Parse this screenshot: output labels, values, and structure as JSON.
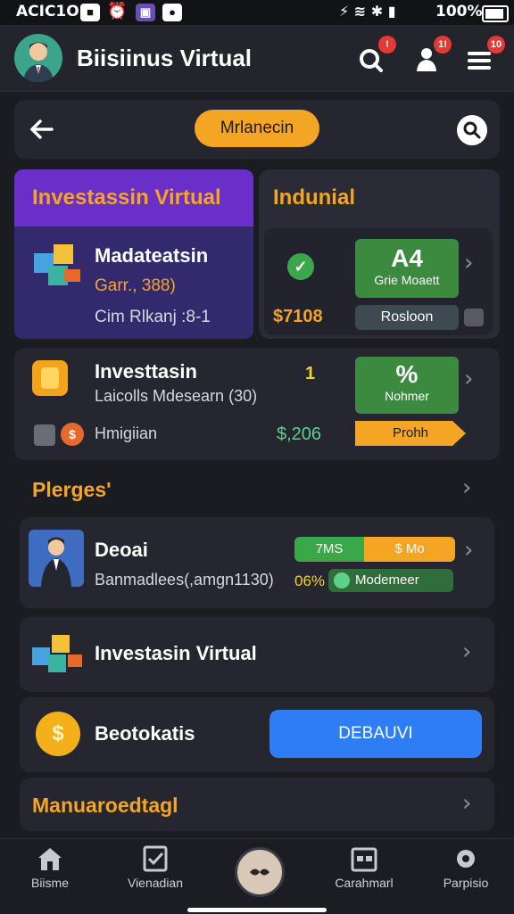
{
  "status_bar": {
    "time": "ACIC1O",
    "battery": "100%"
  },
  "header": {
    "title": "Biisiinus Virtual",
    "badges": [
      "!",
      "1!",
      "10"
    ]
  },
  "subheader": {
    "pill": "Mrlanecin"
  },
  "card_investasi": {
    "title": "Investassin Virtual",
    "item_title": "Madateatsin",
    "item_sub": "Garr., 388)",
    "item_sub2": "Cim Rlkanj :8-1"
  },
  "card_indunial": {
    "title": "Indunial",
    "big": "A4",
    "big_sub": "Grie Moaett",
    "price": "$7108",
    "button": "Rosloon"
  },
  "row_invest": {
    "title": "Investtasin",
    "sub": "Laicolls Mdesearn (30)",
    "num": "1",
    "icon_label": "Hmigiian",
    "price": "$,206",
    "box_big": "%",
    "box_sub": "Nohmer",
    "orange_label": "Prohh"
  },
  "section1": {
    "label": "Plerges'"
  },
  "row_deal": {
    "title": "Deoai",
    "sub": "Banmadlees(,amgn1130)",
    "pct": "06%",
    "left_seg": "7MS",
    "right_seg": "$ Mo",
    "tag": "Modemeer"
  },
  "row_virtual": {
    "title": "Investasin Virtual"
  },
  "row_coins": {
    "title": "Beotokatis",
    "button": "DEBAUVI"
  },
  "section2": {
    "label": "Manuaroedtagl"
  },
  "nav": [
    {
      "label": "Biisme",
      "icon": "home-icon"
    },
    {
      "label": "Vienadian",
      "icon": "tasks-icon"
    },
    {
      "label": "",
      "icon": "center-icon"
    },
    {
      "label": "Carahmarl",
      "icon": "calendar-icon"
    },
    {
      "label": "Parpisio",
      "icon": "settings-icon"
    }
  ],
  "colors": {
    "accent": "#f5a524",
    "purple": "#6a2fc8",
    "green": "#3c8a3f",
    "blue": "#2f7df5",
    "bg": "#1b1c22",
    "card": "#25262f"
  }
}
